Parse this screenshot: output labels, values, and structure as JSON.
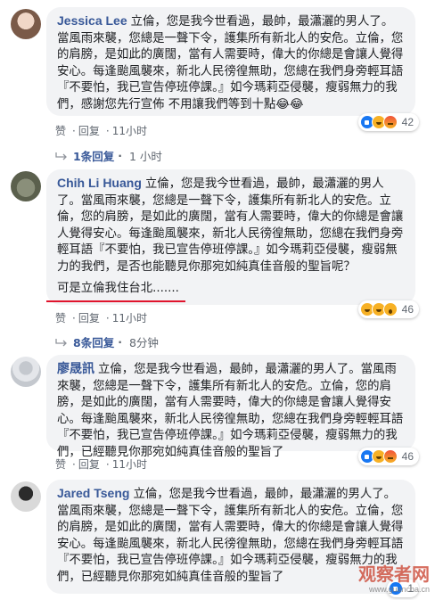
{
  "comments": [
    {
      "author": "Jessica Lee",
      "text": "立倫，您是我今世看過，最帥，最瀟灑的男人了。當風雨來襲，您總是一聲下令，護集所有新北人的安危。立倫，您的肩膀，是如此的廣闊，當有人需要時，偉大的你總是會讓人覺得安心。每逢颱風襲來，新北人民徬徨無助，您總在我們身旁輕耳語『不要怕，我已宣告停班停課。』如今瑪莉亞侵襲，瘦弱無力的我們，感謝您先行宣佈 不用讓我們等到十點😂😂",
      "actions": {
        "like": "赞",
        "reply": "回复",
        "time": "11小时"
      },
      "reaction_count": "42",
      "replies": "1条回复",
      "replies_time": "1 小时"
    },
    {
      "author": "Chih Li Huang",
      "text": "立倫，您是我今世看過，最帥，最瀟灑的男人了。當風雨來襲，您總是一聲下令，護集所有新北人的安危。立倫，您的肩膀，是如此的廣闊，當有人需要時，偉大的你總是會讓人覺得安心。每逢颱風襲來，新北人民徬徨無助，您總在我們身旁輕耳語『不要怕，我已宣告停班停課。』如今瑪莉亞侵襲，瘦弱無力的我們，是否也能聽見你那宛如純真佳音般的聖旨呢？",
      "extra": "可是立倫我住台北.......",
      "actions": {
        "like": "赞",
        "reply": "回复",
        "time": "11小时"
      },
      "reaction_count": "46",
      "replies": "8条回复",
      "replies_time": "8分钟"
    },
    {
      "author": "廖晟訊",
      "text": "立倫，您是我今世看過，最帥，最瀟灑的男人了。當風雨來襲，您總是一聲下令，護集所有新北人的安危。立倫，您的肩膀，是如此的廣闊，當有人需要時，偉大的你總是會讓人覺得安心。每逢颱風襲來，新北人民徬徨無助，您總在我們身旁輕輕耳語『不要怕，我已宣告停班停課。』如今瑪莉亞侵襲，瘦弱無力的我們，已經聽見你那宛如純真佳音般的聖旨了",
      "actions": {
        "like": "赞",
        "reply": "回复",
        "time": "11小时"
      },
      "reaction_count": "46"
    },
    {
      "author": "Jared Tseng",
      "text": "立倫，您是我今世看過，最帥，最瀟灑的男人了。當風雨來襲，您總是一聲下令，護集所有新北人的安危。立倫，您的肩膀，是如此的廣闊，當有人需要時，偉大的你總是會讓人覺得安心。每逢颱風襲來，新北人民徬徨無助，您總在我們身旁輕耳語『不要怕，我已宣告停班停課。』如今瑪莉亞侵襲，瘦弱無力的我們，已經聽見你那宛如純真佳音般的聖旨了",
      "actions": {
        "like": "赞",
        "reply": "回复",
        "time": "11小时"
      },
      "reaction_count": "1"
    }
  ],
  "watermark": {
    "text": "观察者网",
    "sub": "www.guancha.cn"
  },
  "colors": {
    "author": "#385898",
    "bubble": "#f2f3f5",
    "highlight": "#e0142c"
  }
}
